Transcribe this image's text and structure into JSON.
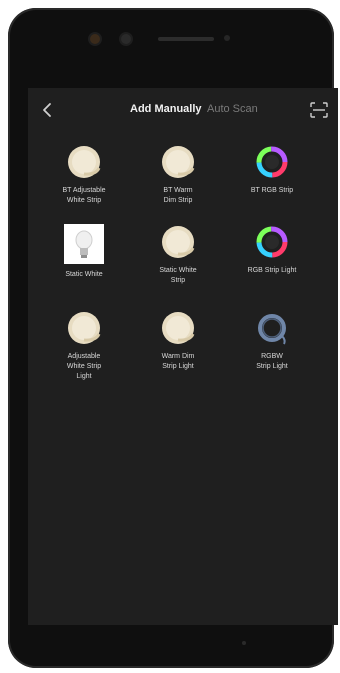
{
  "colors": {
    "background": "#1f1f1f",
    "strip_icon": "#e9dfc6",
    "rgb_ring": "multicolor",
    "rgbw_ring": "#6f86a8",
    "tab_active": "#f2f2f2",
    "tab_inactive": "#7a7a7a"
  },
  "header": {
    "back_icon": "chevron-left-icon",
    "tabs": [
      {
        "label": "Add Manually",
        "active": true
      },
      {
        "label": "Auto Scan",
        "active": false
      }
    ],
    "scan_icon": "scan-frame-icon"
  },
  "devices": [
    {
      "label": "BT Adjustable\nWhite Strip",
      "icon": "led-strip-reel-icon"
    },
    {
      "label": "BT Warm\nDim Strip",
      "icon": "led-strip-reel-icon"
    },
    {
      "label": "BT RGB Strip",
      "icon": "rgb-strip-ring-icon"
    },
    {
      "label": "Static White",
      "icon": "light-bulb-icon"
    },
    {
      "label": "Static White\nStrip",
      "icon": "led-strip-reel-icon"
    },
    {
      "label": "RGB Strip Light",
      "icon": "rgb-strip-ring-icon"
    },
    {
      "label": "Adjustable\nWhite Strip\nLight",
      "icon": "led-strip-reel-icon"
    },
    {
      "label": "Warm Dim\nStrip Light",
      "icon": "led-strip-reel-icon"
    },
    {
      "label": "RGBW\nStrip Light",
      "icon": "rgbw-strip-ring-icon"
    }
  ]
}
